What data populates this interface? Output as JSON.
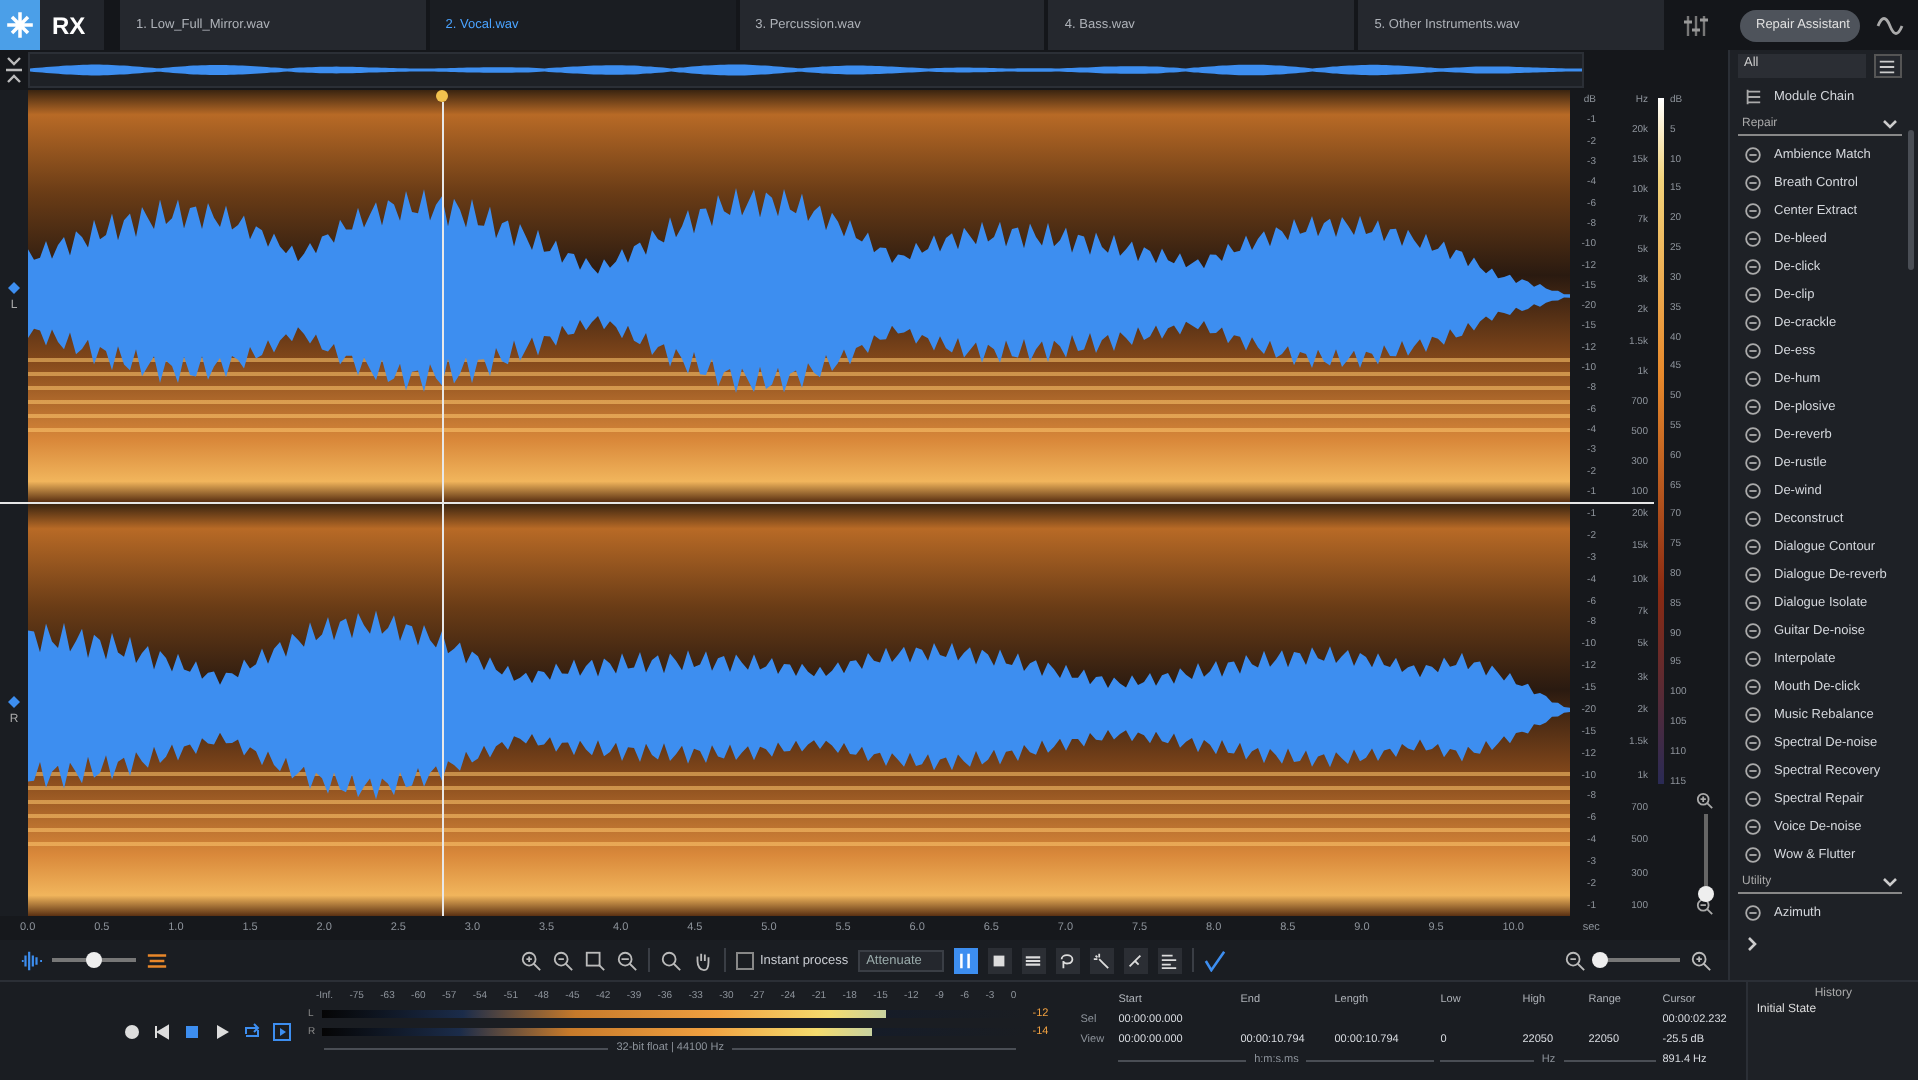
{
  "app": {
    "logo": "RX"
  },
  "tabs": [
    {
      "label": "1. Low_Full_Mirror.wav",
      "selected": false
    },
    {
      "label": "2. Vocal.wav",
      "selected": true
    },
    {
      "label": "3. Percussion.wav",
      "selected": false
    },
    {
      "label": "4. Bass.wav",
      "selected": false
    },
    {
      "label": "5. Other Instruments.wav",
      "selected": false
    }
  ],
  "repair_assistant_button": "Repair Assistant",
  "channels": [
    {
      "label": "L",
      "amp_scale": [
        "dB",
        "-1",
        "-2",
        "-3",
        "-4",
        "-6",
        "-8",
        "-10",
        "-12",
        "-15",
        "-20",
        "-15",
        "-12",
        "-10",
        "-8",
        "-6",
        "-4",
        "-3",
        "-2",
        "-1"
      ],
      "freq_scale": [
        "Hz",
        "20k",
        "15k",
        "10k",
        "7k",
        "5k",
        "3k",
        "2k",
        "1.5k",
        "1k",
        "700",
        "500",
        "300",
        "100"
      ]
    },
    {
      "label": "R",
      "amp_scale": [
        "-1",
        "-2",
        "-3",
        "-4",
        "-6",
        "-8",
        "-10",
        "-12",
        "-15",
        "-20",
        "-15",
        "-12",
        "-10",
        "-8",
        "-6",
        "-4",
        "-3",
        "-2",
        "-1"
      ],
      "freq_scale": [
        "20k",
        "15k",
        "10k",
        "7k",
        "5k",
        "3k",
        "2k",
        "1.5k",
        "1k",
        "700",
        "500",
        "300",
        "100"
      ]
    }
  ],
  "colorbar_scale": [
    "dB",
    "5",
    "10",
    "15",
    "20",
    "25",
    "30",
    "35",
    "40",
    "45",
    "50",
    "55",
    "60",
    "65",
    "70",
    "75",
    "80",
    "85",
    "90",
    "95",
    "100",
    "105",
    "110",
    "115"
  ],
  "vertical_zoom": {
    "level": 0
  },
  "time_ruler": {
    "ticks": [
      "0.0",
      "0.5",
      "1.0",
      "1.5",
      "2.0",
      "2.5",
      "3.0",
      "3.5",
      "4.0",
      "4.5",
      "5.0",
      "5.5",
      "6.0",
      "6.5",
      "7.0",
      "7.5",
      "8.0",
      "8.5",
      "9.0",
      "9.5",
      "10.0"
    ],
    "unit": "sec"
  },
  "toolbar": {
    "waveform_opacity": {
      "level": 0.5
    },
    "instant_process": {
      "label": "Instant process",
      "checked": false
    },
    "mode": "Attenuate",
    "tools": [
      {
        "kind": "time",
        "selected": true
      },
      {
        "kind": "rect",
        "selected": false
      },
      {
        "kind": "freq",
        "selected": false
      },
      {
        "kind": "lasso",
        "selected": false
      },
      {
        "kind": "wand",
        "selected": false
      },
      {
        "kind": "brush",
        "selected": false
      },
      {
        "kind": "harmonic",
        "selected": false
      }
    ],
    "zoom": {
      "level": 0.05
    }
  },
  "module_panel": {
    "filter": "All",
    "module_chain": "Module Chain",
    "groups": [
      {
        "name": "Repair",
        "expanded": true,
        "items": [
          "Ambience Match",
          "Breath Control",
          "Center Extract",
          "De-bleed",
          "De-click",
          "De-clip",
          "De-crackle",
          "De-ess",
          "De-hum",
          "De-plosive",
          "De-reverb",
          "De-rustle",
          "De-wind",
          "Deconstruct",
          "Dialogue Contour",
          "Dialogue De-reverb",
          "Dialogue Isolate",
          "Guitar De-noise",
          "Interpolate",
          "Mouth De-click",
          "Music Rebalance",
          "Spectral De-noise",
          "Spectral Recovery",
          "Spectral Repair",
          "Voice De-noise",
          "Wow & Flutter"
        ]
      },
      {
        "name": "Utility",
        "expanded": true,
        "items": [
          "Azimuth"
        ]
      }
    ]
  },
  "meter": {
    "scale": [
      "-Inf.",
      "-75",
      "-63",
      "-60",
      "-57",
      "-54",
      "-51",
      "-48",
      "-45",
      "-42",
      "-39",
      "-36",
      "-33",
      "-30",
      "-27",
      "-24",
      "-21",
      "-18",
      "-15",
      "-12",
      "-9",
      "-6",
      "-3",
      "0"
    ],
    "channels": [
      {
        "label": "L",
        "level": 0.8,
        "peak": "-12"
      },
      {
        "label": "R",
        "level": 0.78,
        "peak": "-14"
      }
    ],
    "format": "32-bit float | 44100 Hz"
  },
  "selection_info": {
    "headers": [
      "Start",
      "End",
      "Length",
      "Low",
      "High",
      "Range",
      "Cursor"
    ],
    "sel": {
      "label": "Sel",
      "start": "00:00:00.000"
    },
    "view": {
      "label": "View",
      "start": "00:00:00.000",
      "end": "00:00:10.794",
      "length": "00:00:10.794",
      "low": "0",
      "high": "22050",
      "range": "22050"
    },
    "cursor": [
      "00:00:02.232",
      "-25.5 dB",
      "891.4 Hz"
    ],
    "time_unit": "h:m:s.ms",
    "freq_unit": "Hz"
  },
  "history": {
    "title": "History",
    "items": [
      {
        "label": "Initial State",
        "selected": false
      }
    ]
  }
}
